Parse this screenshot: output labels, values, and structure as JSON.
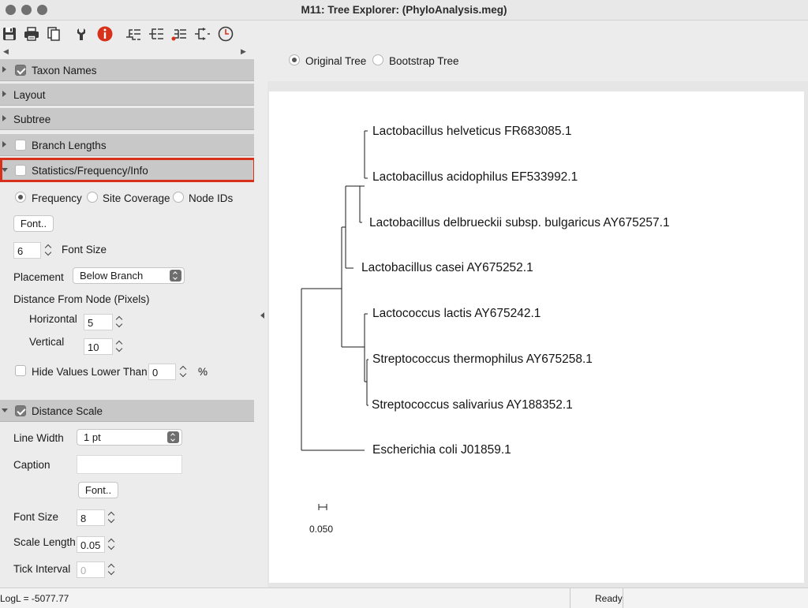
{
  "window": {
    "title": "M11: Tree Explorer: (PhyloAnalysis.meg)"
  },
  "toolbar": {
    "icons": [
      "save-icon",
      "print-icon",
      "copy-icon",
      "options-icon",
      "info-icon",
      "tree-layout-icon",
      "tree-align-icon",
      "tree-rooted-icon",
      "flip-icon",
      "timer-icon"
    ],
    "accent": "#d8311b"
  },
  "panel": {
    "taxon_names": {
      "label": "Taxon Names",
      "checked": true
    },
    "layout": {
      "label": "Layout"
    },
    "subtree": {
      "label": "Subtree"
    },
    "branch_lengths": {
      "label": "Branch Lengths",
      "checked": false
    },
    "statistics": {
      "label": "Statistics/Frequency/Info",
      "checked": false,
      "display_options": [
        "Frequency",
        "Site Coverage",
        "Node IDs"
      ],
      "font_button": "Font..",
      "font_size": "6",
      "font_size_label": "Font Size",
      "placement_label": "Placement",
      "placement_value": "Below Branch",
      "distance_label": "Distance From Node (Pixels)",
      "horizontal_label": "Horizontal",
      "horizontal_value": "5",
      "vertical_label": "Vertical",
      "vertical_value": "10",
      "hide_label": "Hide Values Lower Than",
      "hide_value": "0",
      "hide_unit": "%"
    },
    "distance_scale": {
      "label": "Distance Scale",
      "checked": true,
      "line_width_label": "Line Width",
      "line_width_value": "1 pt",
      "caption_label": "Caption",
      "caption_value": "",
      "font_button": "Font..",
      "font_size_label": "Font Size",
      "font_size_value": "8",
      "scale_length_label": "Scale Length",
      "scale_length_value": "0.05",
      "tick_interval_label": "Tick Interval",
      "tick_interval_value": "0"
    }
  },
  "view": {
    "original_tree": "Original Tree",
    "bootstrap_tree": "Bootstrap Tree",
    "selected": "Original Tree"
  },
  "tree": {
    "taxa": [
      "Lactobacillus helveticus FR683085.1",
      "Lactobacillus acidophilus EF533992.1",
      "Lactobacillus delbrueckii subsp. bulgaricus AY675257.1",
      "Lactobacillus casei AY675252.1",
      "Lactococcus lactis AY675242.1",
      "Streptococcus thermophilus AY675258.1",
      "Streptococcus salivarius AY188352.1",
      "Escherichia coli J01859.1"
    ],
    "scale_label": "0.050"
  },
  "status": {
    "logl": "LogL = -5077.77",
    "state": "Ready"
  }
}
